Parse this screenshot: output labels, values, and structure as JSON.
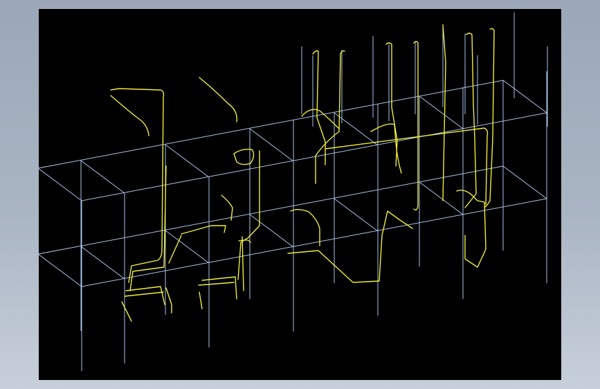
{
  "colors": {
    "background_top": "#9ba7b7",
    "background_bottom": "#c7cfda",
    "viewport": "#000000",
    "frame_lines": "#a9c4ea",
    "pipe_lines": "#f2ee3a"
  }
}
